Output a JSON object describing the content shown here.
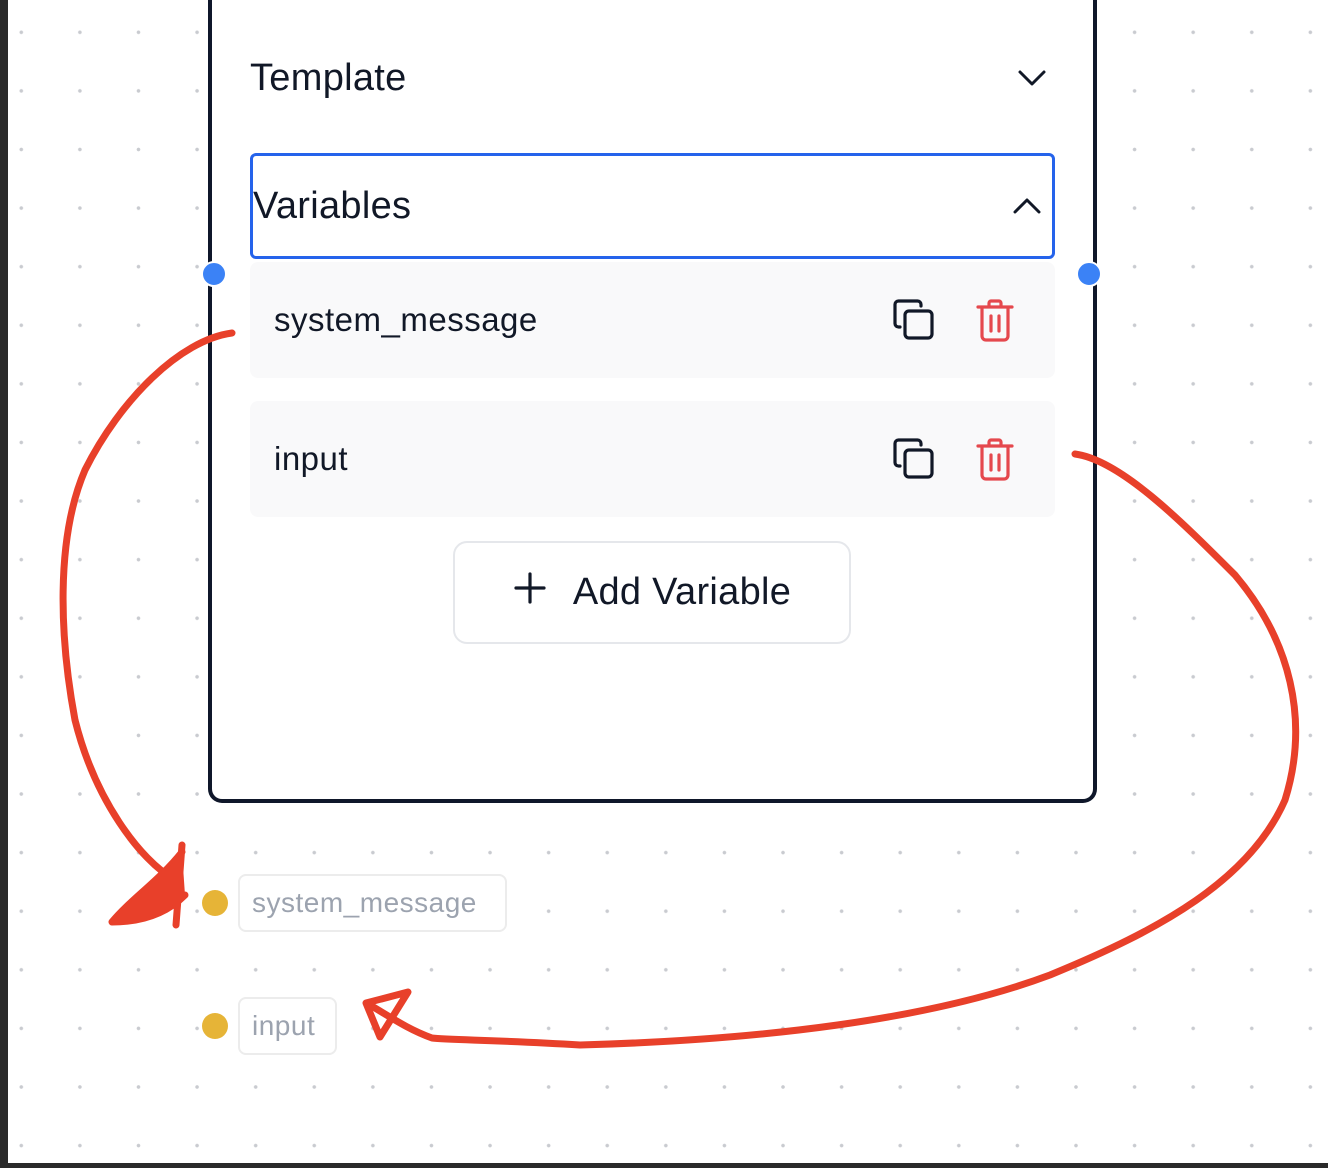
{
  "node": {
    "template_section": {
      "label": "Template",
      "icon": "chevron-down-icon"
    },
    "variables_section": {
      "label": "Variables",
      "icon": "chevron-up-icon",
      "items": [
        {
          "name": "system_message",
          "actions": [
            "copy-icon",
            "trash-icon"
          ]
        },
        {
          "name": "input",
          "actions": [
            "copy-icon",
            "trash-icon"
          ]
        }
      ],
      "add_button": {
        "icon": "plus-icon",
        "label": "Add Variable"
      }
    }
  },
  "outputs": [
    {
      "label": "system_message"
    },
    {
      "label": "input"
    }
  ],
  "colors": {
    "node_border": "#0f172a",
    "focus_border": "#2563eb",
    "handle": "#3b82f6",
    "output_dot": "#e6b437",
    "delete_icon": "#e5484d",
    "annotation_ink": "#e8402a"
  }
}
